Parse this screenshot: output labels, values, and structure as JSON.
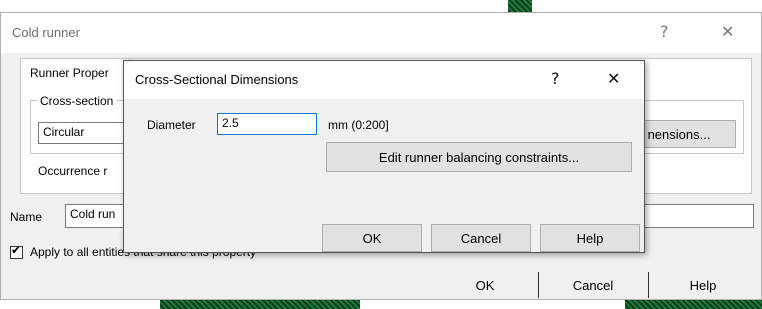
{
  "main_dialog": {
    "title": "Cold runner",
    "help_glyph": "?",
    "close_glyph": "✕",
    "tab_label": "Runner Proper",
    "cross_section_group": "Cross-section",
    "shape_value": "Circular",
    "dimensions_button": "nensions...",
    "occurrence_label": "Occurrence r",
    "name_label": "Name",
    "name_value": "Cold run",
    "apply_label": "Apply to all entities that share this property",
    "ok": "OK",
    "cancel": "Cancel",
    "help": "Help"
  },
  "sub_dialog": {
    "title": "Cross-Sectional Dimensions",
    "help_glyph": "?",
    "close_glyph": "✕",
    "diameter_label": "Diameter",
    "diameter_value": "2.5",
    "diameter_unit": "mm (0:200]",
    "edit_button": "Edit runner balancing constraints...",
    "ok": "OK",
    "cancel": "Cancel",
    "help": "Help"
  },
  "icons": {
    "checkbox": "checkmark-icon"
  },
  "colors": {
    "focus_blue": "#0078d7",
    "mesh_green": "#1f7a3a"
  }
}
